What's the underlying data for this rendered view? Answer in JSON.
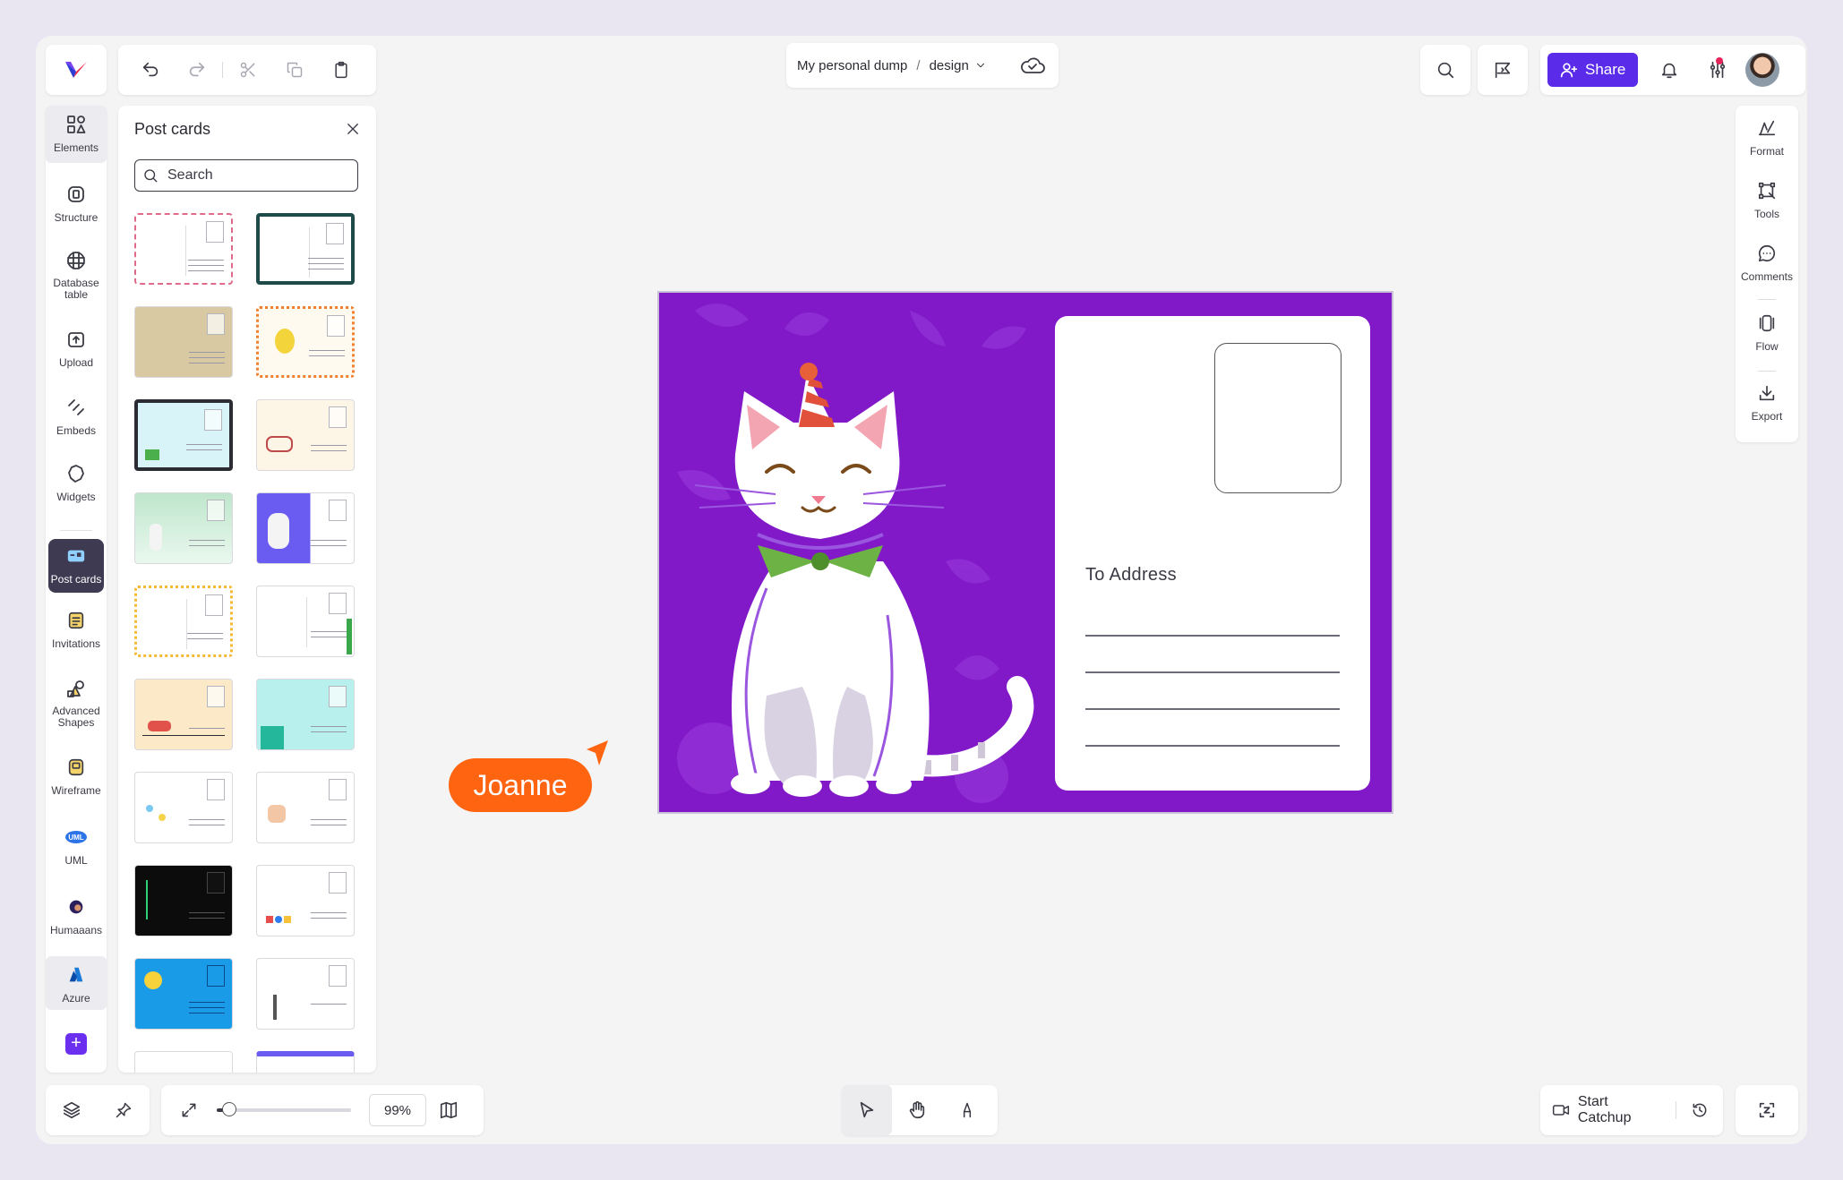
{
  "breadcrumb": {
    "workspace": "My personal dump",
    "separator": "/",
    "page": "design"
  },
  "top": {
    "share_label": "Share"
  },
  "sidebar": {
    "items": [
      {
        "label": "Elements",
        "icon": "shapes-icon"
      },
      {
        "label": "Structure",
        "icon": "structure-icon"
      },
      {
        "label": "Database table",
        "icon": "database-table-icon"
      },
      {
        "label": "Upload",
        "icon": "upload-icon"
      },
      {
        "label": "Embeds",
        "icon": "embed-icon"
      },
      {
        "label": "Widgets",
        "icon": "widgets-icon"
      },
      {
        "label": "Post cards",
        "icon": "postcard-icon"
      },
      {
        "label": "Invitations",
        "icon": "invitation-icon"
      },
      {
        "label": "Advanced Shapes",
        "icon": "advanced-shapes-icon"
      },
      {
        "label": "Wireframe",
        "icon": "wireframe-icon"
      },
      {
        "label": "UML",
        "icon": "uml-icon"
      },
      {
        "label": "Humaaans",
        "icon": "humaaans-icon"
      },
      {
        "label": "Azure",
        "icon": "azure-icon"
      }
    ],
    "add_label": "+"
  },
  "postcards_panel": {
    "title": "Post cards",
    "search_placeholder": "Search"
  },
  "right_rail": {
    "items": [
      {
        "label": "Format",
        "icon": "format-icon"
      },
      {
        "label": "Tools",
        "icon": "tools-icon"
      },
      {
        "label": "Comments",
        "icon": "comments-icon"
      },
      {
        "label": "Flow",
        "icon": "flow-icon"
      },
      {
        "label": "Export",
        "icon": "export-icon"
      }
    ]
  },
  "canvas": {
    "to_address_label": "To Address",
    "collaborator_cursor": "Joanne"
  },
  "bottom": {
    "zoom": "99%",
    "zoom_level": 0.09,
    "start_catchup": "Start Catchup"
  },
  "colors": {
    "accent": "#5b2bea",
    "postcard_bg": "#8119c9",
    "cursor": "#ff6410",
    "rail_active": "#3d3a52"
  }
}
